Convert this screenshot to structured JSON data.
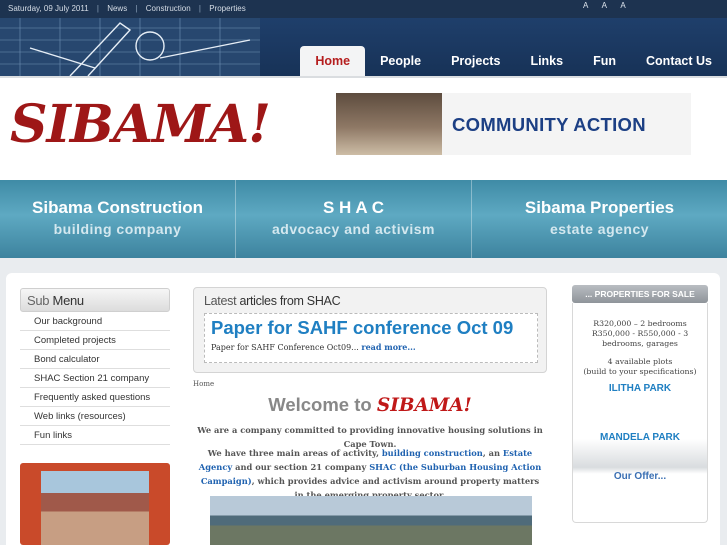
{
  "topbar": {
    "date": "Saturday, 09 July 2011",
    "links": [
      "News",
      "Construction",
      "Properties"
    ],
    "font_sizes": "A A A"
  },
  "nav": {
    "items": [
      {
        "label": "Home",
        "active": true
      },
      {
        "label": "People",
        "active": false
      },
      {
        "label": "Projects",
        "active": false
      },
      {
        "label": "Links",
        "active": false
      },
      {
        "label": "Fun",
        "active": false
      },
      {
        "label": "Contact Us",
        "active": false
      }
    ]
  },
  "banner": {
    "logo": "SIBAMA!",
    "community_action": "COMMUNITY ACTION"
  },
  "divisions": [
    {
      "title": "Sibama Construction",
      "subtitle": "building company"
    },
    {
      "title": "S H A C",
      "subtitle": "advocacy and activism"
    },
    {
      "title": "Sibama Properties",
      "subtitle": "estate agency"
    }
  ],
  "submenu": {
    "heading_light": "Sub",
    "heading_bold": "Menu",
    "items": [
      "Our background",
      "Completed projects",
      "Bond calculator",
      "SHAC Section 21 company",
      "Frequently asked questions",
      "Web links (resources)",
      "Fun links"
    ]
  },
  "latest": {
    "heading_light": "Latest",
    "heading_bold": "articles from SHAC",
    "title": "Paper for SAHF conference Oct 09",
    "summary": "Paper for SAHF Conference Oct09...",
    "read_more": "read more..."
  },
  "content": {
    "breadcrumb": "Home",
    "welcome_prefix": "Welcome to",
    "welcome_brand": "SIBAMA!",
    "intro": "We are a company committed to providing innovative housing solutions in Cape Town.",
    "p2_a": "We have three main areas of activity,",
    "p2_link1": "building construction",
    "p2_b": ", an",
    "p2_link2": "Estate Agency",
    "p2_c": "and our section 21 company",
    "p2_link3": "SHAC (the Suburban Housing Action Campaign)",
    "p2_d": ", which provides advice and activism around property matters in the emerging property sector."
  },
  "properties": {
    "heading": "... PROPERTIES FOR SALE",
    "line1": "R320,000 – 2 bedrooms",
    "line2": "R350,000 - R550,000 - 3",
    "line3": "bedrooms, garages",
    "line4": "4 available plots",
    "line5": "(build to your specifications)",
    "ilitha": "ILITHA PARK",
    "mandela": "MANDELA PARK",
    "offer": "Our Offer..."
  },
  "colors": {
    "brand_red": "#9e1717",
    "nav_blue": "#1f3f6b",
    "strip_teal": "#4e9bb5",
    "link_blue": "#1f7fc2"
  }
}
